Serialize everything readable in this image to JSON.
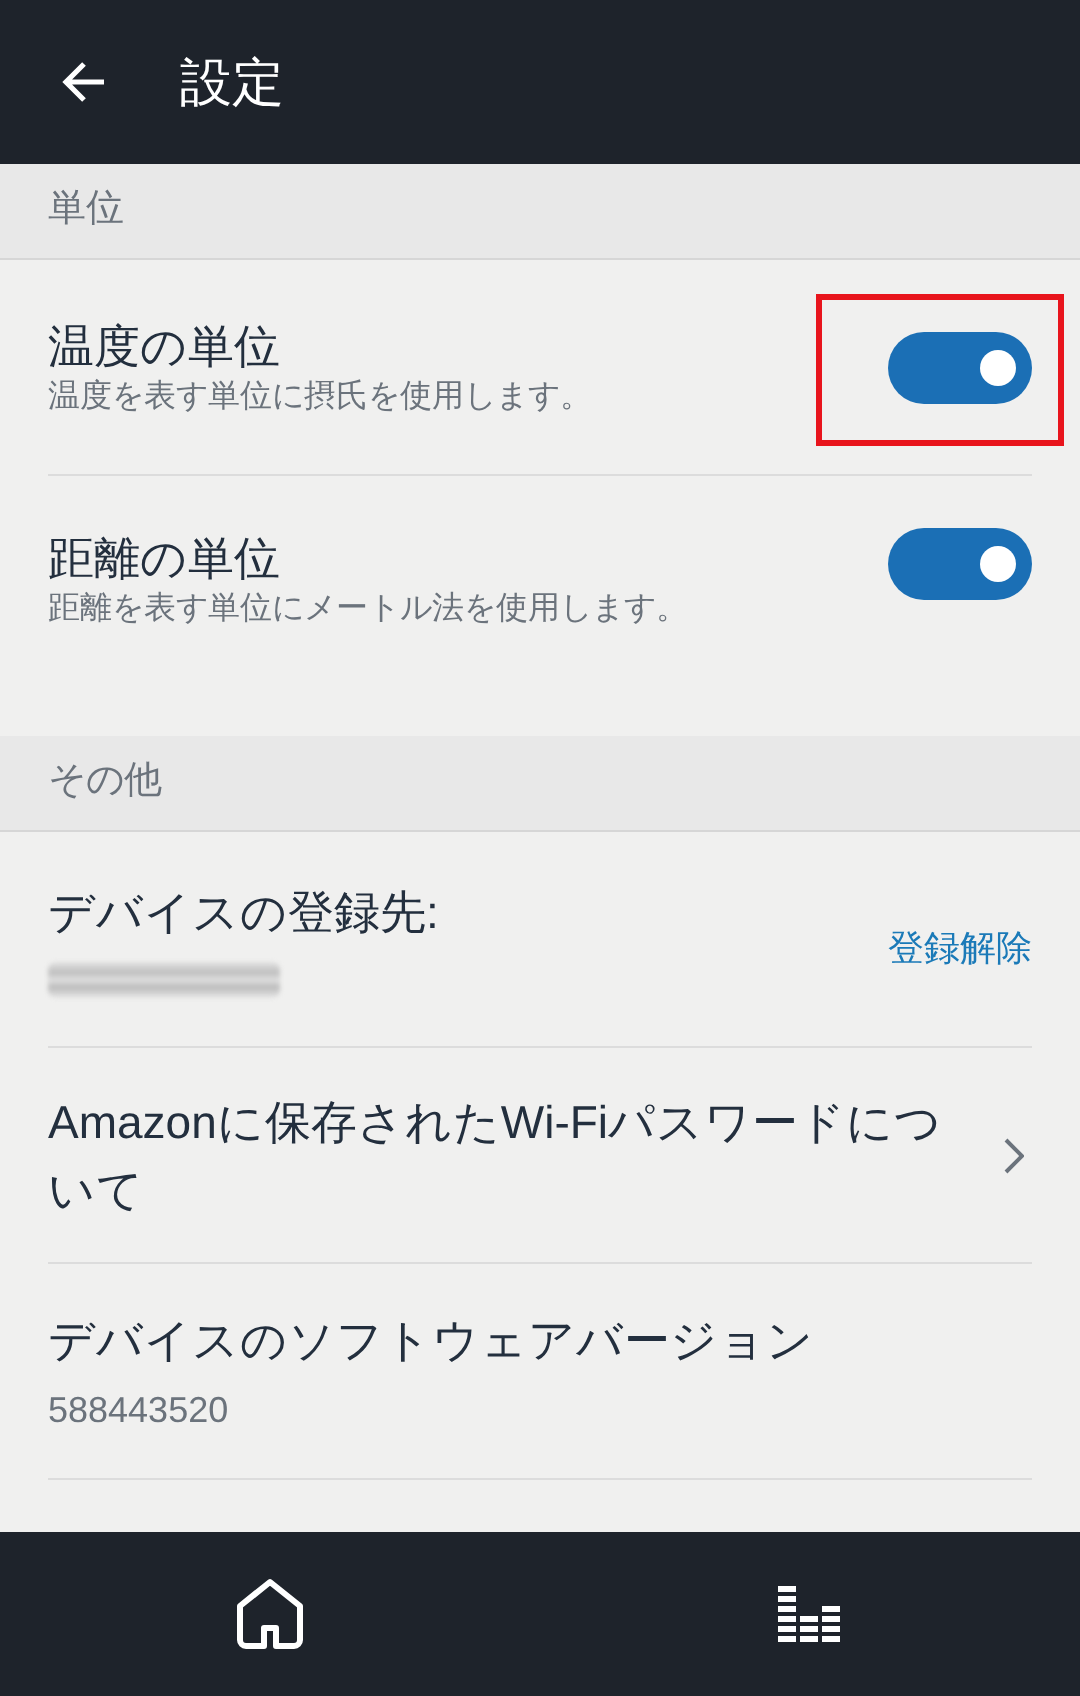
{
  "header": {
    "title": "設定"
  },
  "sections": [
    {
      "title": "単位",
      "items": [
        {
          "kind": "toggle",
          "title": "温度の単位",
          "subtitle": "温度を表す単位に摂氏を使用します。",
          "on": true,
          "highlighted": true
        },
        {
          "kind": "toggle",
          "title": "距離の単位",
          "subtitle": "距離を表す単位にメートル法を使用します。",
          "on": true,
          "highlighted": false
        }
      ]
    },
    {
      "title": "その他",
      "items": [
        {
          "kind": "account",
          "title": "デバイスの登録先:",
          "action": "登録解除"
        },
        {
          "kind": "link",
          "title": "Amazonに保存されたWi-Fiパスワードについて"
        },
        {
          "kind": "info",
          "title": "デバイスのソフトウェアバージョン",
          "subtitle": "588443520"
        }
      ]
    }
  ],
  "bottom_nav": [
    {
      "kind": "home"
    },
    {
      "kind": "equalizer"
    }
  ]
}
